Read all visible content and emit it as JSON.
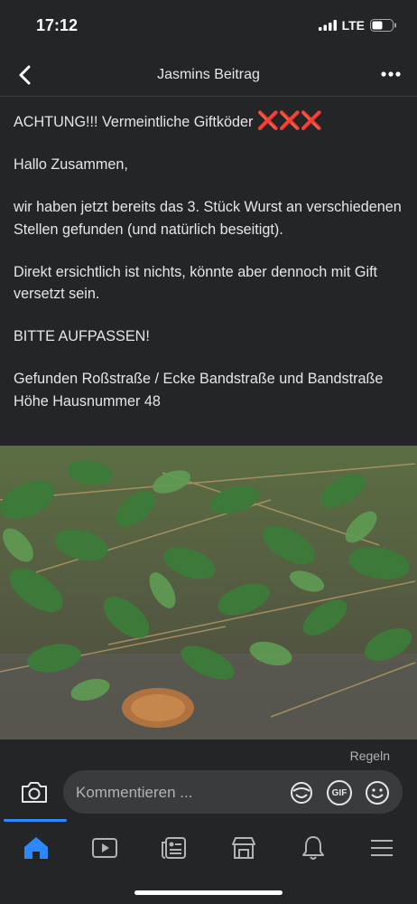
{
  "status": {
    "time": "17:12",
    "network": "LTE"
  },
  "nav": {
    "title": "Jasmins Beitrag"
  },
  "post": {
    "headline": "ACHTUNG!!! Vermeintliche Giftköder",
    "headline_marks": "❌❌❌",
    "paragraphs": [
      "Hallo Zusammen,",
      "wir haben jetzt bereits das 3. Stück Wurst an verschiedenen Stellen gefunden (und natürlich beseitigt).",
      "Direkt ersichtlich ist nichts, könnte aber dennoch mit Gift versetzt sein.",
      "BITTE AUFPASSEN!",
      "Gefunden Roßstraße / Ecke Bandstraße und Bandstraße Höhe Hausnummer 48"
    ]
  },
  "rules_link": "Regeln",
  "comment": {
    "placeholder": "Kommentieren ...",
    "gif_label": "GIF"
  },
  "tabs": [
    "home-icon",
    "video-icon",
    "news-icon",
    "marketplace-icon",
    "bell-icon",
    "menu-icon"
  ],
  "colors": {
    "accent": "#2d88ff",
    "background": "#242526",
    "alert": "#e0242c"
  }
}
